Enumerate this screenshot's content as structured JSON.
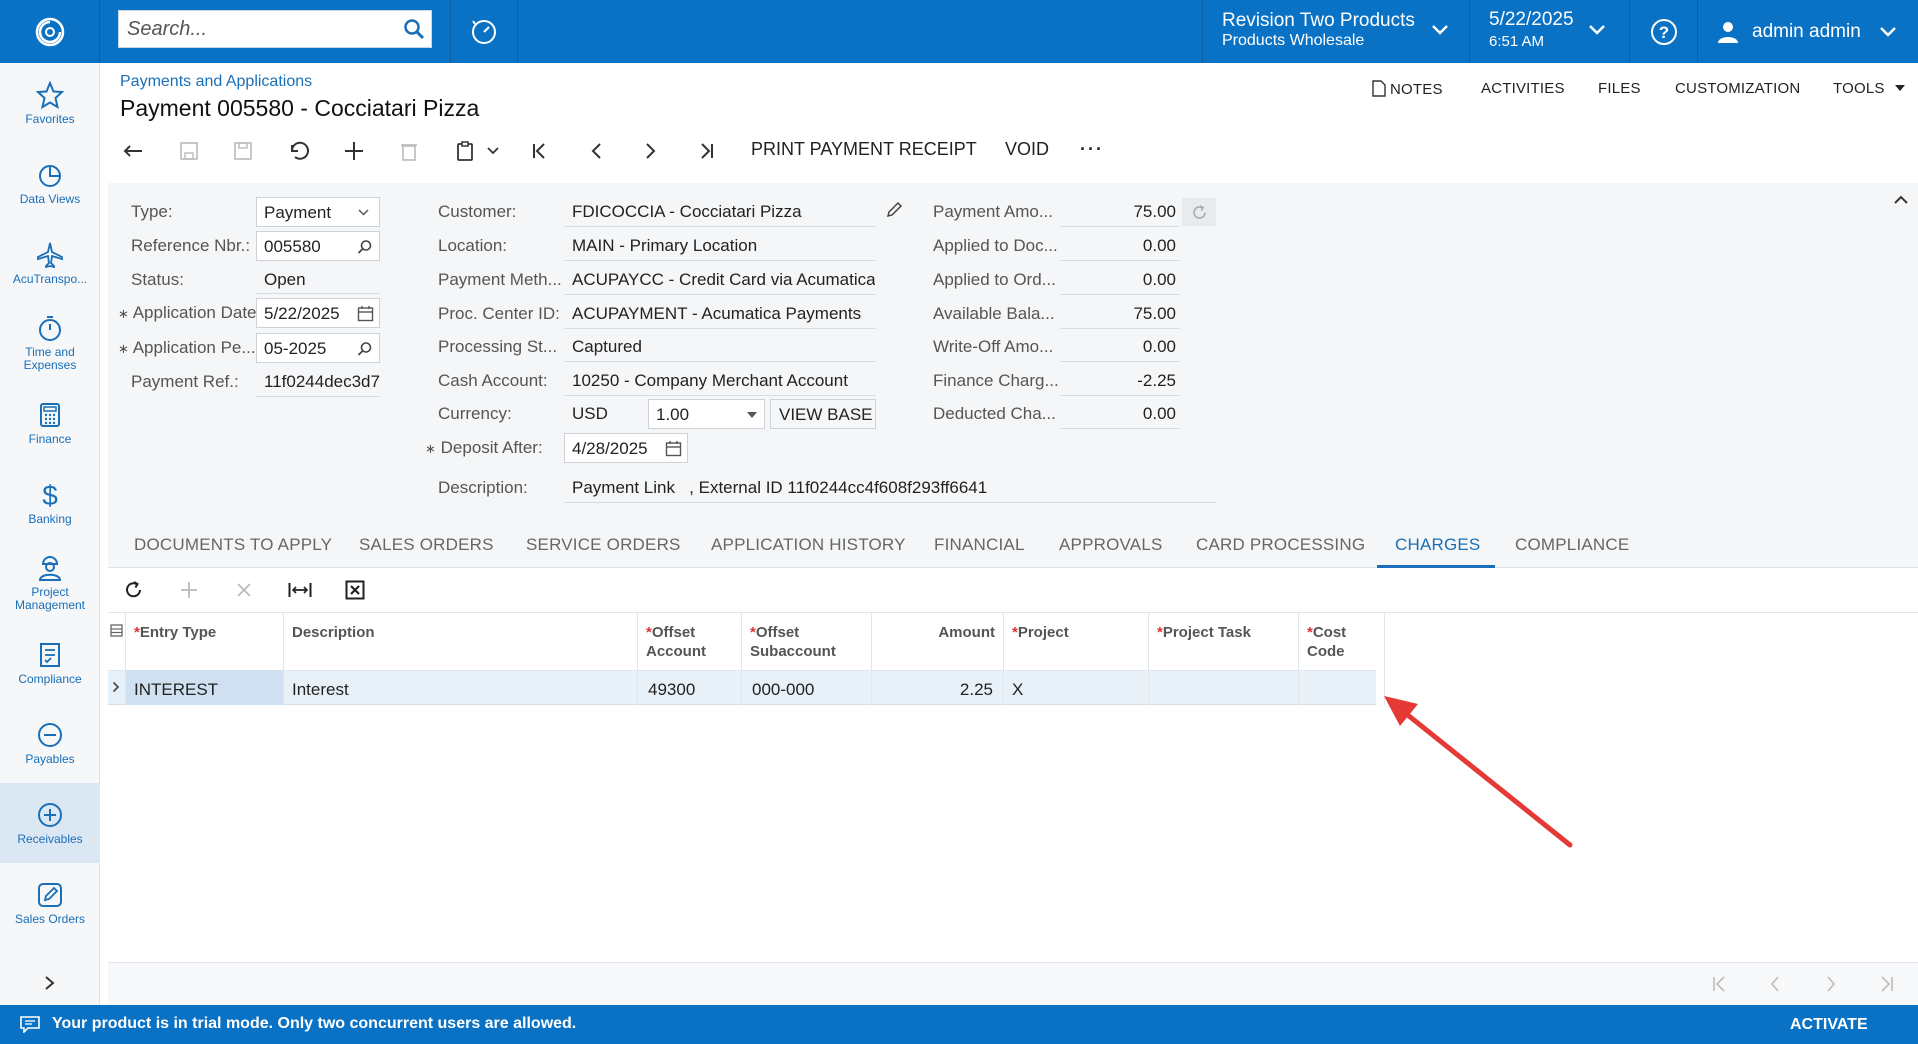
{
  "topbar": {
    "search_placeholder": "Search...",
    "company_name": "Revision Two Products",
    "branch_name": "Products Wholesale",
    "date": "5/22/2025",
    "time": "6:51 AM",
    "user_name": "admin admin"
  },
  "nav": [
    {
      "label": "Favorites",
      "icon": "star-icon"
    },
    {
      "label": "Data Views",
      "icon": "pie-chart-icon"
    },
    {
      "label": "AcuTranspo...",
      "icon": "airplane-icon"
    },
    {
      "label": "Time and Expenses",
      "icon": "stopwatch-icon"
    },
    {
      "label": "Finance",
      "icon": "calculator-icon"
    },
    {
      "label": "Banking",
      "icon": "dollar-icon"
    },
    {
      "label": "Project Management",
      "icon": "worker-icon"
    },
    {
      "label": "Compliance",
      "icon": "checklist-icon"
    },
    {
      "label": "Payables",
      "icon": "minus-circle-icon"
    },
    {
      "label": "Receivables",
      "icon": "plus-circle-icon"
    },
    {
      "label": "Sales Orders",
      "icon": "pencil-icon"
    }
  ],
  "header": {
    "breadcrumb": "Payments and Applications",
    "title": "Payment 005580 - Cocciatari Pizza",
    "links": [
      "NOTES",
      "ACTIVITIES",
      "FILES",
      "CUSTOMIZATION",
      "TOOLS"
    ]
  },
  "toolbar": {
    "print_label": "PRINT PAYMENT RECEIPT",
    "void_label": "VOID",
    "more_label": "···"
  },
  "form": {
    "type_label": "Type:",
    "type_value": "Payment",
    "refnbr_label": "Reference Nbr.:",
    "refnbr_value": "005580",
    "status_label": "Status:",
    "status_value": "Open",
    "appdate_label": "Application Date:",
    "appdate_value": "5/22/2025",
    "appperiod_label": "Application Pe...",
    "appperiod_value": "05-2025",
    "payref_label": "Payment Ref.:",
    "payref_value": "11f0244dec3d7",
    "customer_label": "Customer:",
    "customer_value": "FDICOCCIA - Cocciatari Pizza",
    "location_label": "Location:",
    "location_value": "MAIN - Primary Location",
    "paymethod_label": "Payment Meth...",
    "paymethod_value": "ACUPAYCC - Credit Card via Acumatica I",
    "proccenter_label": "Proc. Center ID:",
    "proccenter_value": "ACUPAYMENT - Acumatica Payments",
    "procstatus_label": "Processing St...",
    "procstatus_value": "Captured",
    "cashacct_label": "Cash Account:",
    "cashacct_value": "10250 - Company Merchant Account",
    "currency_label": "Currency:",
    "currency_value": "USD",
    "currency_rate": "1.00",
    "viewbase_label": "VIEW BASE",
    "deposit_label": "Deposit After:",
    "deposit_value": "4/28/2025",
    "description_label": "Description:",
    "description_value": "Payment Link   , External ID 11f0244cc4f608f293ff6641",
    "payamt_label": "Payment Amo...",
    "payamt_value": "75.00",
    "applieddoc_label": "Applied to Doc...",
    "applieddoc_value": "0.00",
    "appliedord_label": "Applied to Ord...",
    "appliedord_value": "0.00",
    "availbal_label": "Available Bala...",
    "availbal_value": "75.00",
    "writeoff_label": "Write-Off Amo...",
    "writeoff_value": "0.00",
    "financechg_label": "Finance Charg...",
    "financechg_value": "-2.25",
    "deducted_label": "Deducted Cha...",
    "deducted_value": "0.00"
  },
  "tabs": [
    "DOCUMENTS TO APPLY",
    "SALES ORDERS",
    "SERVICE ORDERS",
    "APPLICATION HISTORY",
    "FINANCIAL",
    "APPROVALS",
    "CARD PROCESSING",
    "CHARGES",
    "COMPLIANCE"
  ],
  "active_tab": "CHARGES",
  "grid": {
    "columns": [
      {
        "label": "Entry Type",
        "required": true
      },
      {
        "label": "Description",
        "required": false
      },
      {
        "label": "Offset Account",
        "required": true
      },
      {
        "label": "Offset Subaccount",
        "required": true
      },
      {
        "label": "Amount",
        "required": false
      },
      {
        "label": "Project",
        "required": true
      },
      {
        "label": "Project Task",
        "required": true
      },
      {
        "label": "Cost Code",
        "required": true
      }
    ],
    "rows": [
      {
        "entry_type": "INTEREST",
        "description": "Interest",
        "offset_account": "49300",
        "offset_subaccount": "000-000",
        "amount": "2.25",
        "project": "X",
        "project_task": "",
        "cost_code": ""
      }
    ]
  },
  "footer": {
    "trial_message": "Your product is in trial mode. Only two concurrent users are allowed.",
    "activate_label": "ACTIVATE"
  },
  "colors": {
    "brand": "#0a72c4",
    "accent": "#1a6fb8",
    "annotation_arrow": "#e53935"
  }
}
